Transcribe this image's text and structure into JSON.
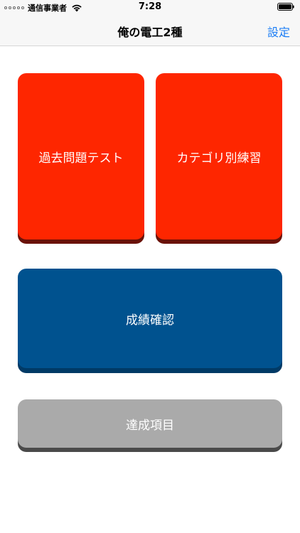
{
  "status_bar": {
    "carrier": "通信事業者",
    "time": "7:28"
  },
  "nav": {
    "title": "俺の電工2種",
    "settings_label": "設定"
  },
  "tiles": {
    "past_exam": "過去問題テスト",
    "category_practice": "カテゴリ別練習",
    "results": "成績確認",
    "achievements": "達成項目"
  },
  "colors": {
    "accent": "#1a7cf5",
    "red_tile": "#fe2600",
    "blue_tile": "#00528f",
    "gray_tile": "#aaaaaa"
  },
  "icons": {
    "wifi": "wifi-icon",
    "battery": "battery-icon",
    "signal": "signal-dots-icon"
  }
}
